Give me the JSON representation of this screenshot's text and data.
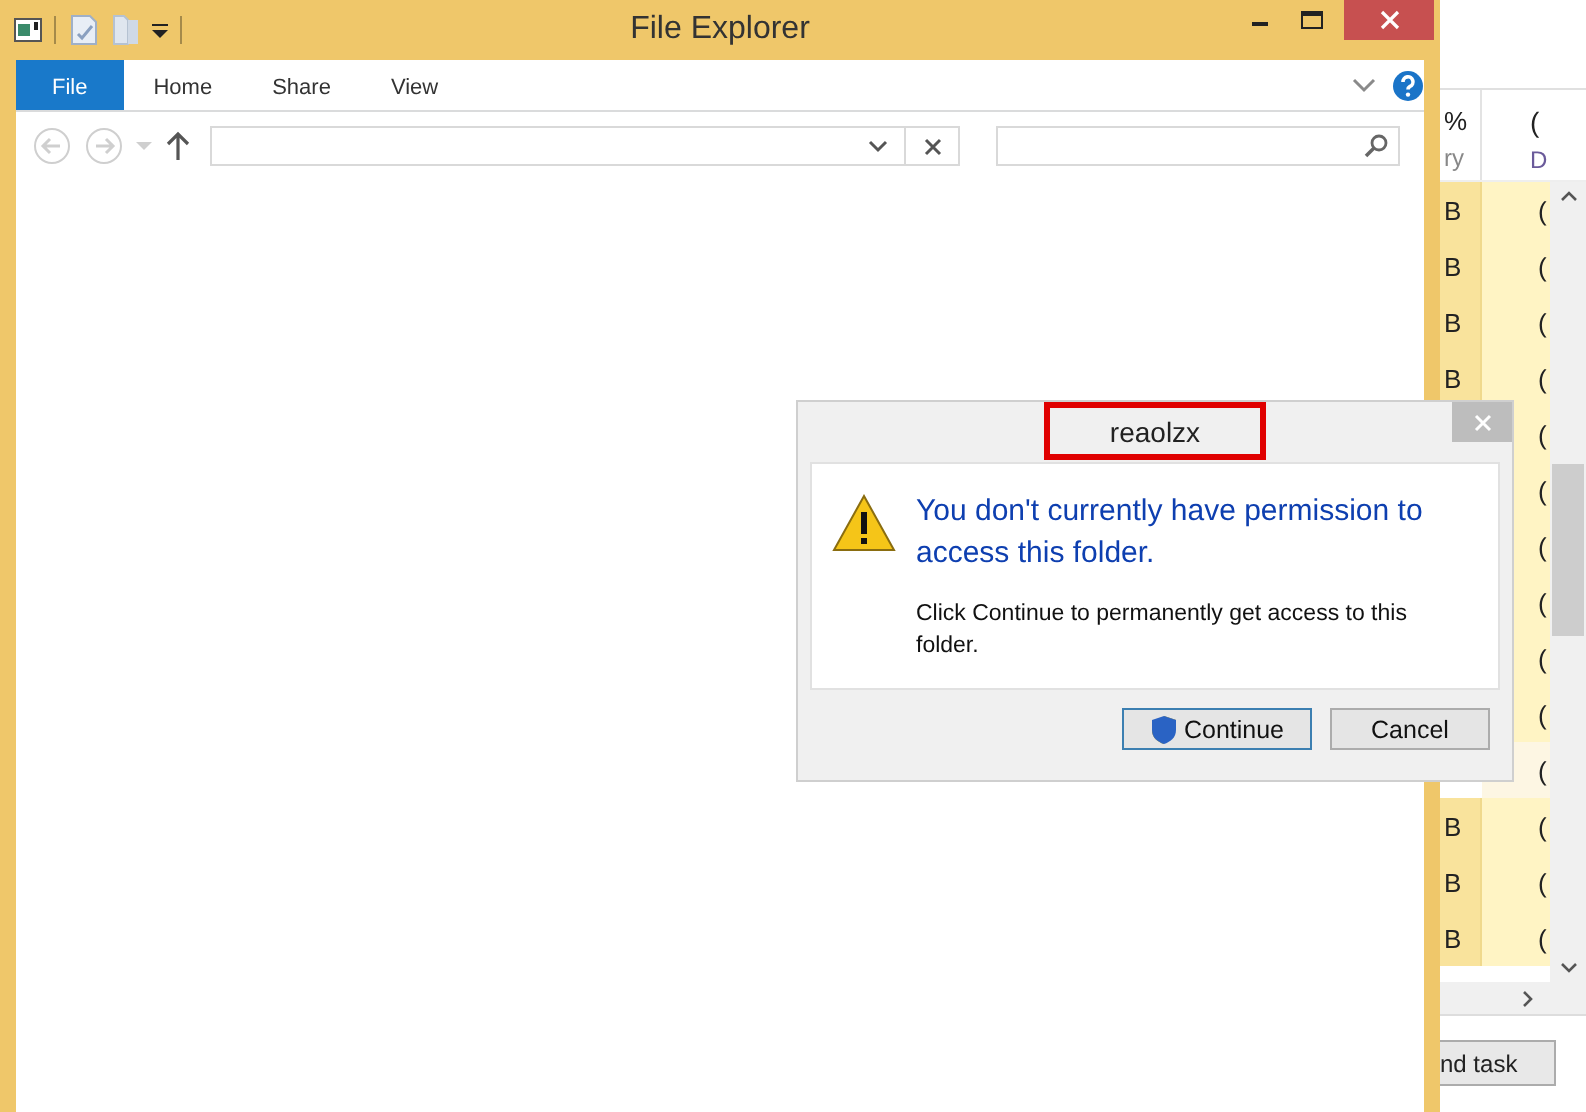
{
  "explorer": {
    "title": "File Explorer",
    "ribbon_tabs": [
      {
        "label": "File",
        "selected": true
      },
      {
        "label": "Home",
        "selected": false
      },
      {
        "label": "Share",
        "selected": false
      },
      {
        "label": "View",
        "selected": false
      }
    ]
  },
  "background_window": {
    "columns": [
      {
        "lines": [
          "%",
          "ry"
        ]
      },
      {
        "lines": [
          "(",
          "D"
        ]
      }
    ],
    "rows": [
      {
        "column_1": "B",
        "column_2": "(",
        "selected": false
      },
      {
        "column_1": "B",
        "column_2": "(",
        "selected": false
      },
      {
        "column_1": "B",
        "column_2": "(",
        "selected": false
      },
      {
        "column_1": "B",
        "column_2": "(",
        "selected": false
      },
      {
        "column_2": "(",
        "selected": false
      },
      {
        "column_2": "(",
        "selected": false
      },
      {
        "column_2": "(",
        "selected": false
      },
      {
        "column_2": "(",
        "selected": false
      },
      {
        "column_2": "(",
        "selected": false
      },
      {
        "column_2": "(",
        "selected": false
      },
      {
        "column_2": "(",
        "selected": true
      },
      {
        "column_1": "B",
        "column_2": "(",
        "selected": false
      },
      {
        "column_1": "B",
        "column_2": "(",
        "selected": false
      },
      {
        "column_1": "B",
        "column_2": "(",
        "selected": false
      }
    ],
    "button": "nd task"
  },
  "dialog": {
    "title": "reaolzx",
    "title_highlighted": true,
    "heading": "You don't currently have permission to access this folder.",
    "message": "Click Continue to permanently get access to this folder.",
    "buttons": [
      {
        "label": "Continue",
        "kind": "elevated",
        "default": true
      },
      {
        "label": "Cancel",
        "kind": "plain",
        "default": false
      }
    ]
  }
}
